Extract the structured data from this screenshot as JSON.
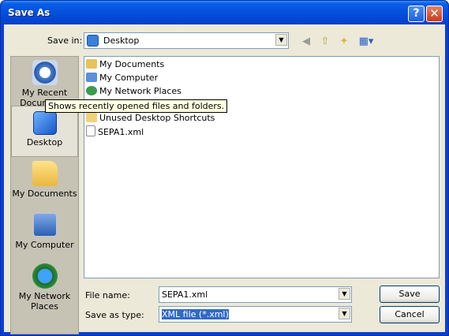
{
  "window": {
    "title": "Save As",
    "help_glyph": "?",
    "close_glyph": "✕"
  },
  "toolbar": {
    "save_in_label": "Save in:",
    "save_in_value": "Desktop",
    "icons": [
      "back-icon",
      "up-folder-icon",
      "new-folder-icon",
      "view-menu-icon"
    ]
  },
  "places": [
    {
      "label": "My Recent Documents"
    },
    {
      "label": "Desktop"
    },
    {
      "label": "My Documents"
    },
    {
      "label": "My Computer"
    },
    {
      "label": "My Network Places"
    }
  ],
  "files": [
    {
      "name": "My Documents"
    },
    {
      "name": "My Computer"
    },
    {
      "name": "My Network Places"
    },
    {
      "name": "Unused Desktop Shortcuts"
    },
    {
      "name": "SEPA1.xml"
    }
  ],
  "tooltip": "Shows recently opened files and folders.",
  "form": {
    "file_name_label": "File name:",
    "file_name_value": "SEPA1.xml",
    "save_type_label": "Save as type:",
    "save_type_value": "XML file (*.xml)"
  },
  "buttons": {
    "save": "Save",
    "cancel": "Cancel"
  },
  "colors": {
    "title_bar": "#0553e0",
    "dialog_bg": "#ece9d8",
    "selection": "#316ac5",
    "tooltip_bg": "#ffffe1"
  }
}
